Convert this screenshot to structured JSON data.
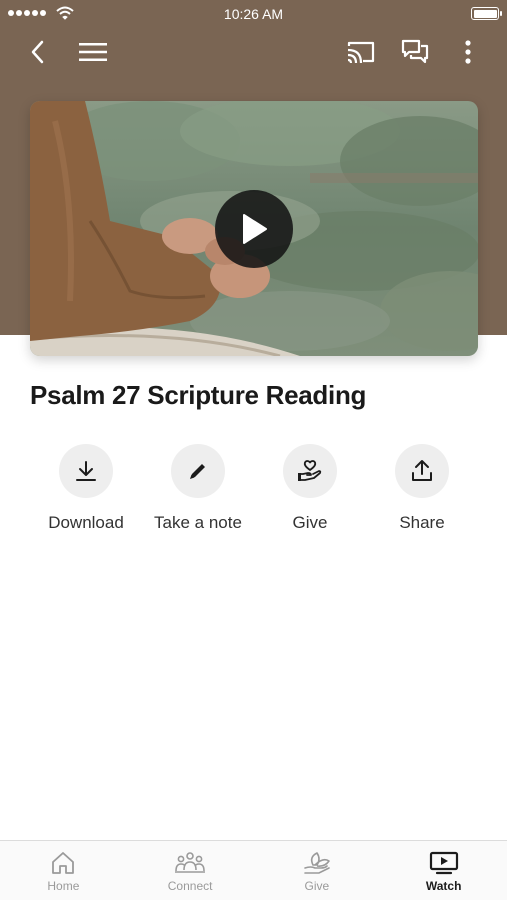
{
  "status_bar": {
    "time": "10:26 AM"
  },
  "nav": {
    "back_icon": "chevron-left-icon",
    "menu_icon": "hamburger-menu-icon",
    "cast_icon": "cast-icon",
    "chat_icon": "chat-bubbles-icon",
    "more_icon": "more-vertical-icon"
  },
  "colors": {
    "header_brown": "#7a6553",
    "tab_active": "#1c1c1c",
    "tab_inactive": "#9a9a9a"
  },
  "video": {
    "title": "Psalm 27 Scripture Reading",
    "play_icon": "play-icon"
  },
  "actions": [
    {
      "label": "Download",
      "icon": "download-icon"
    },
    {
      "label": "Take a note",
      "icon": "pencil-icon"
    },
    {
      "label": "Give",
      "icon": "heart-hand-icon"
    },
    {
      "label": "Share",
      "icon": "share-icon"
    }
  ],
  "tabs": [
    {
      "label": "Home",
      "icon": "home-icon",
      "active": false
    },
    {
      "label": "Connect",
      "icon": "people-icon",
      "active": false
    },
    {
      "label": "Give",
      "icon": "leaf-hand-icon",
      "active": false
    },
    {
      "label": "Watch",
      "icon": "tv-play-icon",
      "active": true
    }
  ]
}
